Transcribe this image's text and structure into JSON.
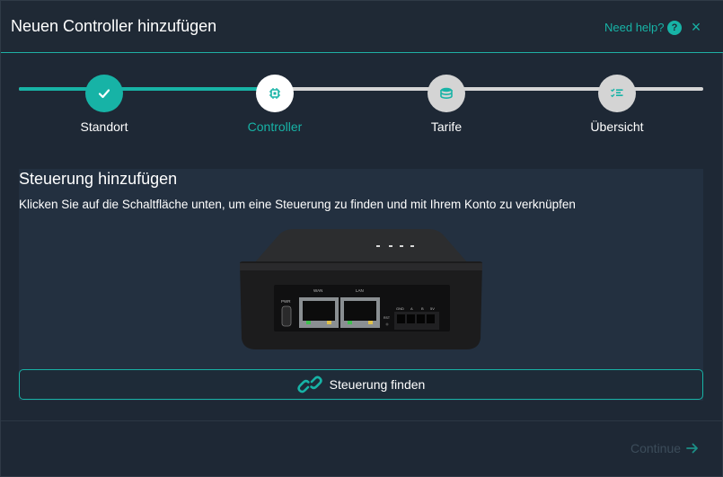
{
  "header": {
    "title": "Neuen Controller hinzufügen",
    "help_label": "Need help?",
    "help_icon": "?",
    "close_icon": "×"
  },
  "stepper": {
    "steps": [
      {
        "label": "Standort",
        "state": "done",
        "icon": "check-icon"
      },
      {
        "label": "Controller",
        "state": "active",
        "icon": "chip-icon"
      },
      {
        "label": "Tarife",
        "state": "todo",
        "icon": "coins-icon"
      },
      {
        "label": "Übersicht",
        "state": "todo",
        "icon": "checklist-icon"
      }
    ],
    "progress": 0.33
  },
  "panel": {
    "title": "Steuerung hinzufügen",
    "description": "Klicken Sie auf die Schaltfläche unten, um eine Steuerung zu finden und mit Ihrem Konto zu verknüpfen",
    "device_labels": {
      "pwr": "PWR",
      "wan": "WAN",
      "lan": "LAN",
      "rst": "RST",
      "gnd": "GND",
      "a": "A",
      "b": "B",
      "v5": "5V"
    }
  },
  "actions": {
    "find_label": "Steuerung finden",
    "continue_label": "Continue"
  },
  "colors": {
    "accent": "#17b3a6",
    "background": "#1e2835",
    "panel": "#233040",
    "disabled_text": "#3c4c5a"
  }
}
